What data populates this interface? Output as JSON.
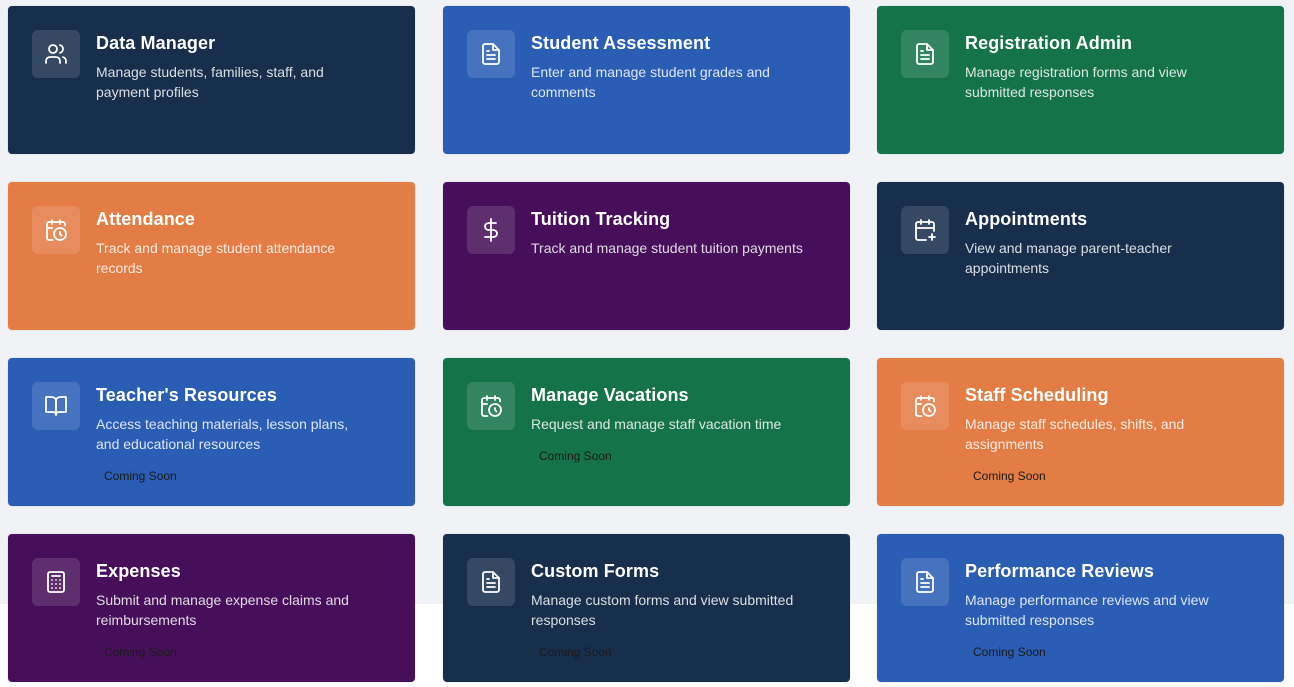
{
  "colors": {
    "navy": "#172e4d",
    "blue": "#2b5db5",
    "green": "#15734a",
    "orange": "#e47d45",
    "purple": "#470f5a"
  },
  "cards": [
    {
      "title": "Data Manager",
      "description": "Manage students, families, staff, and payment profiles",
      "icon": "users-icon",
      "color": "navy"
    },
    {
      "title": "Student Assessment",
      "description": "Enter and manage student grades and comments",
      "icon": "document-icon",
      "color": "blue"
    },
    {
      "title": "Registration Admin",
      "description": "Manage registration forms and view submitted responses",
      "icon": "document-icon",
      "color": "green"
    },
    {
      "title": "Attendance",
      "description": "Track and manage student attendance records",
      "icon": "calendar-clock-icon",
      "color": "orange"
    },
    {
      "title": "Tuition Tracking",
      "description": "Track and manage student tuition payments",
      "icon": "dollar-icon",
      "color": "purple"
    },
    {
      "title": "Appointments",
      "description": "View and manage parent-teacher appointments",
      "icon": "calendar-plus-icon",
      "color": "navy"
    },
    {
      "title": "Teacher's Resources",
      "description": "Access teaching materials, lesson plans, and educational resources",
      "icon": "book-icon",
      "color": "blue",
      "badge": "Coming Soon"
    },
    {
      "title": "Manage Vacations",
      "description": "Request and manage staff vacation time",
      "icon": "calendar-clock-icon",
      "color": "green",
      "badge": "Coming Soon"
    },
    {
      "title": "Staff Scheduling",
      "description": "Manage staff schedules, shifts, and assignments",
      "icon": "calendar-clock-icon",
      "color": "orange",
      "badge": "Coming Soon"
    },
    {
      "title": "Expenses",
      "description": "Submit and manage expense claims and reimbursements",
      "icon": "calculator-icon",
      "color": "purple",
      "badge": "Coming Soon"
    },
    {
      "title": "Custom Forms",
      "description": "Manage custom forms and view submitted responses",
      "icon": "document-icon",
      "color": "navy",
      "badge": "Coming Soon"
    },
    {
      "title": "Performance Reviews",
      "description": "Manage performance reviews and view submitted responses",
      "icon": "document-icon",
      "color": "blue",
      "badge": "Coming Soon"
    }
  ]
}
